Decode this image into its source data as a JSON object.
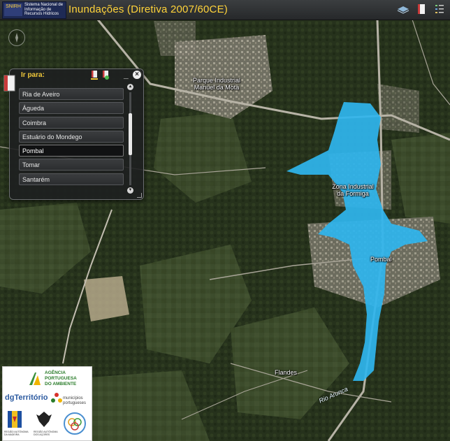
{
  "header": {
    "logo_badge": "SNIRH",
    "logo_text": "Sistema Nacional de Informação de Recursos Hídricos",
    "title": "Inundações (Diretiva 2007/60CE)"
  },
  "panel": {
    "title": "Ir para:",
    "minimize_label": "_",
    "close_label": "×",
    "items": [
      {
        "label": "Ria de Aveiro"
      },
      {
        "label": "Águeda"
      },
      {
        "label": "Coimbra"
      },
      {
        "label": "Estuário do Mondego"
      },
      {
        "label": "Pombal",
        "selected": true
      },
      {
        "label": "Tomar"
      },
      {
        "label": "Santarém"
      }
    ],
    "selected_item": "Pombal"
  },
  "map": {
    "labels": {
      "parque": "Parque Industrial Manuel da Mota",
      "zona": "Zona Industrial da Formiga",
      "pombal": "Pombal",
      "flandes": "Flandes",
      "rio": "Rio  Arunca"
    },
    "flood_color": "#2fb5ee"
  },
  "logos": {
    "apa_line1": "AGÊNCIA",
    "apa_line2": "PORTUGUESA",
    "apa_line3": "DO AMBIENTE",
    "dgt": "dgTerritório",
    "anmp": "municípios portugueses",
    "madeira": "REGIÃO AUTÓNOMA DA MADEIRA",
    "acores": "REGIÃO AUTÓNOMA DOS AÇORES"
  }
}
